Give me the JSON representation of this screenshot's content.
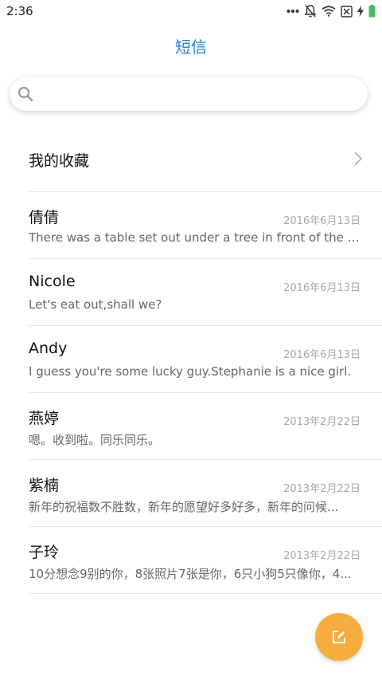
{
  "status_bar": {
    "time": "2:36",
    "icons": [
      "more-dots-icon",
      "bell-muted-icon",
      "wifi-icon",
      "sim-off-icon",
      "charging-bolt-icon",
      "battery-icon"
    ]
  },
  "header": {
    "title": "短信"
  },
  "search": {
    "placeholder": "",
    "value": "",
    "icon": "search-icon"
  },
  "favorites": {
    "label": "我的收藏"
  },
  "messages": [
    {
      "name": "倩倩",
      "date": "2016年6月13日",
      "preview": "There was a table set out under a tree in front of the ho..."
    },
    {
      "name": "Nicole",
      "date": "2016年6月13日",
      "preview": "Let's eat out,shall we?"
    },
    {
      "name": "Andy",
      "date": "2016年6月13日",
      "preview": "I guess you're some lucky guy.Stephanie is a nice girl."
    },
    {
      "name": "燕婷",
      "date": "2013年2月22日",
      "preview": "嗯。收到啦。同乐同乐。"
    },
    {
      "name": "紫楠",
      "date": "2013年2月22日",
      "preview": "新年的祝福数不胜数，新年的愿望好多好多，新年的问候..."
    },
    {
      "name": "子玲",
      "date": "2013年2月22日",
      "preview": "10分想念9别的你，8张照片7张是你，6只小狗5只像你，4..."
    }
  ],
  "fab": {
    "icon": "compose-icon"
  },
  "colors": {
    "accent": "#1f83d8",
    "fab": "#f5ae3e",
    "battery": "#3fbf5f"
  }
}
